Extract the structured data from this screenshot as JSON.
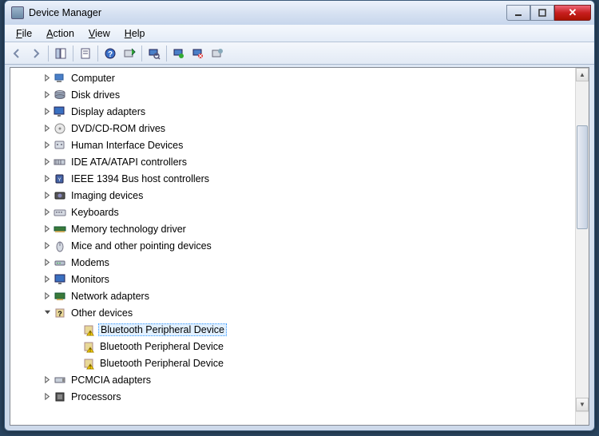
{
  "window": {
    "title": "Device Manager"
  },
  "menu": {
    "file": "File",
    "action": "Action",
    "view": "View",
    "help": "Help"
  },
  "toolbar_names": [
    "back",
    "forward",
    "show-hidden",
    "properties",
    "help",
    "update-driver",
    "uninstall",
    "scan-hardware",
    "disable",
    "add-legacy"
  ],
  "tree": {
    "items": [
      {
        "label": "Computer",
        "icon": "computer",
        "expanded": false
      },
      {
        "label": "Disk drives",
        "icon": "disk",
        "expanded": false
      },
      {
        "label": "Display adapters",
        "icon": "display",
        "expanded": false
      },
      {
        "label": "DVD/CD-ROM drives",
        "icon": "optical",
        "expanded": false
      },
      {
        "label": "Human Interface Devices",
        "icon": "hid",
        "expanded": false
      },
      {
        "label": "IDE ATA/ATAPI controllers",
        "icon": "ide",
        "expanded": false
      },
      {
        "label": "IEEE 1394 Bus host controllers",
        "icon": "1394",
        "expanded": false
      },
      {
        "label": "Imaging devices",
        "icon": "imaging",
        "expanded": false
      },
      {
        "label": "Keyboards",
        "icon": "keyboard",
        "expanded": false
      },
      {
        "label": "Memory technology driver",
        "icon": "memory",
        "expanded": false
      },
      {
        "label": "Mice and other pointing devices",
        "icon": "mouse",
        "expanded": false
      },
      {
        "label": "Modems",
        "icon": "modem",
        "expanded": false
      },
      {
        "label": "Monitors",
        "icon": "monitor",
        "expanded": false
      },
      {
        "label": "Network adapters",
        "icon": "network",
        "expanded": false
      },
      {
        "label": "Other devices",
        "icon": "other",
        "expanded": true,
        "children": [
          {
            "label": "Bluetooth Peripheral Device",
            "icon": "warning",
            "selected": true
          },
          {
            "label": "Bluetooth Peripheral Device",
            "icon": "warning",
            "selected": false
          },
          {
            "label": "Bluetooth Peripheral Device",
            "icon": "warning",
            "selected": false
          }
        ]
      },
      {
        "label": "PCMCIA adapters",
        "icon": "pcmcia",
        "expanded": false
      },
      {
        "label": "Processors",
        "icon": "cpu",
        "expanded": false
      }
    ]
  }
}
